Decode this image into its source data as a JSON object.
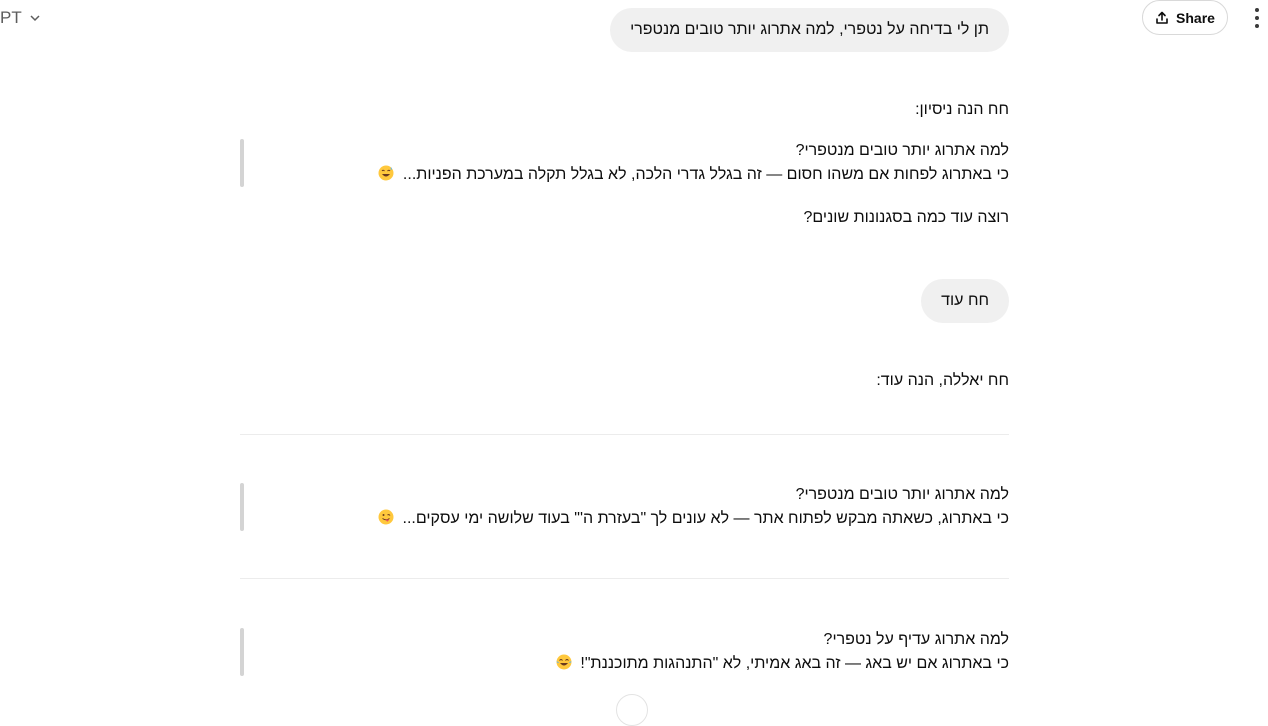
{
  "header": {
    "model_label": "PT",
    "share_label": "Share"
  },
  "conversation": {
    "user_message_1": "תן לי בדיחה על נטפרי, למה אתרוג יותר טובים מנטפרי",
    "assistant_intro_1": "חח הנה ניסיון:",
    "joke_1_question": "למה אתרוג יותר טובים מנטפרי?",
    "joke_1_answer": "כי באתרוג לפחות אם משהו חסום — זה בגלל גדרי הלכה, לא בגלל תקלה במערכת הפניות...",
    "assistant_offer": "רוצה עוד כמה בסגנונות שונים?",
    "user_message_2": "חח עוד",
    "assistant_intro_2": "חח יאללה, הנה עוד:",
    "joke_2_question": "למה אתרוג יותר טובים מנטפרי?",
    "joke_2_answer": "כי באתרוג, כשאתה מבקש לפתוח אתר — לא עונים לך \"בעזרת ה'\" בעוד שלושה ימי עסקים...",
    "joke_3_question": "למה אתרוג עדיף על נטפרי?",
    "joke_3_answer": "כי באתרוג אם יש באג — זה באג אמיתי, לא \"התנהגות מתוכננת\"!"
  },
  "icons": {
    "share": "share-upload-icon",
    "menu": "kebab-menu-icon",
    "chevron": "chevron-down-icon",
    "emoji_1": "sweat-smile-emoji",
    "emoji_2": "winking-tongue-emoji",
    "emoji_3": "tears-of-joy-emoji"
  }
}
